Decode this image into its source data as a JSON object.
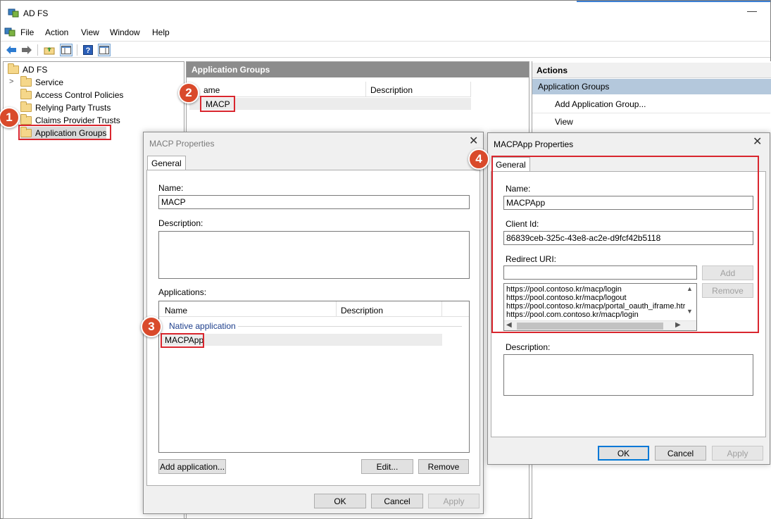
{
  "app": {
    "title": "AD FS"
  },
  "menu": [
    "File",
    "Action",
    "View",
    "Window",
    "Help"
  ],
  "tree": {
    "root": "AD FS",
    "items": [
      "Service",
      "Access Control Policies",
      "Relying Party Trusts",
      "Claims Provider Trusts",
      "Application Groups"
    ]
  },
  "middle": {
    "header": "Application Groups",
    "columns": [
      "ame",
      "Description"
    ],
    "rows": [
      "MACP"
    ]
  },
  "actions": {
    "header": "Actions",
    "group": "Application Groups",
    "items": [
      "Add Application Group...",
      "View"
    ]
  },
  "badges": [
    "1",
    "2",
    "3",
    "4"
  ],
  "macp_dialog": {
    "title": "MACP Properties",
    "tab": "General",
    "name_label": "Name:",
    "name_value": "MACP",
    "description_label": "Description:",
    "applications_label": "Applications:",
    "app_columns": [
      "Name",
      "Description"
    ],
    "app_group": "Native application",
    "app_item": "MACPApp",
    "add_btn": "Add application...",
    "edit_btn": "Edit...",
    "remove_btn": "Remove",
    "ok": "OK",
    "cancel": "Cancel",
    "apply": "Apply"
  },
  "macpapp_dialog": {
    "title": "MACPApp Properties",
    "tab": "General",
    "name_label": "Name:",
    "name_value": "MACPApp",
    "client_id_label": "Client Id:",
    "client_id_value": "86839ceb-325c-43e8-ac2e-d9fcf42b5118",
    "redirect_label": "Redirect URI:",
    "redirect_value": "",
    "add_btn": "Add",
    "remove_btn": "Remove",
    "uris": [
      "https://pool.contoso.kr/macp/login",
      "https://pool.contoso.kr/macp/logout",
      "https://pool.contoso.kr/macp/portal_oauth_iframe.htr",
      "https://pool.com.contoso.kr/macp/login"
    ],
    "description_label": "Description:",
    "ok": "OK",
    "cancel": "Cancel",
    "apply": "Apply"
  },
  "colors": {
    "accent": "#0078d7",
    "highlight_red": "#d9262e",
    "badge": "#d94a2b",
    "pane_header": "#8c8c8c",
    "selection": "#b4c8dc"
  }
}
